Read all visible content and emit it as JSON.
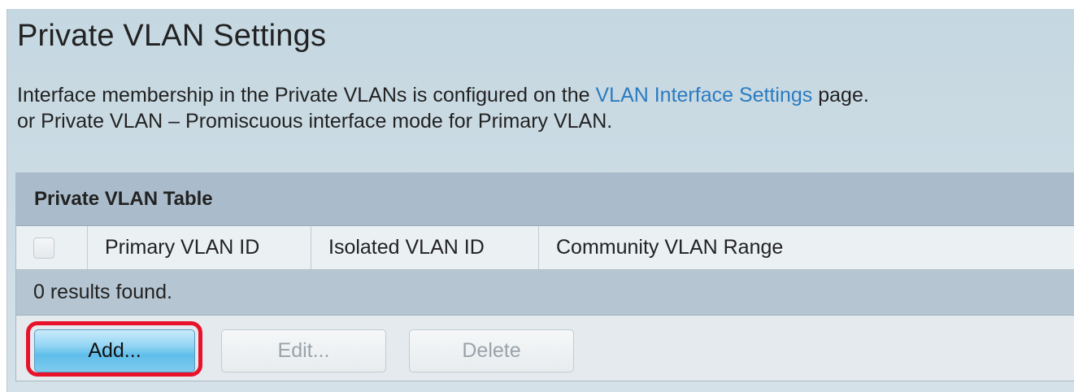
{
  "page": {
    "title": "Private VLAN Settings",
    "description_line1_prefix": "Interface membership in the Private VLANs is configured on the ",
    "description_link": "VLAN Interface Settings",
    "description_line1_suffix": " page.",
    "description_line2": "or Private VLAN – Promiscuous interface mode for Primary VLAN."
  },
  "table": {
    "title": "Private VLAN Table",
    "columns": [
      "Primary VLAN ID",
      "Isolated VLAN ID",
      "Community VLAN Range"
    ],
    "select_all_checked": false,
    "rows": [],
    "results_text": "0 results found."
  },
  "buttons": {
    "add_label": "Add...",
    "edit_label": "Edit...",
    "delete_label": "Delete",
    "edit_enabled": false,
    "delete_enabled": false
  },
  "colors": {
    "link": "#2b7bbf",
    "highlight": "#e8132b",
    "primary_button": "#5fbde9"
  }
}
